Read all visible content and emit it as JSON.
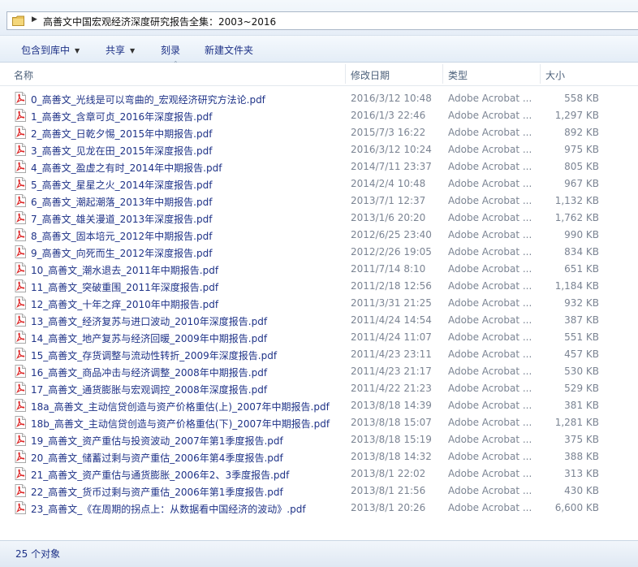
{
  "address": {
    "path": "高善文中国宏观经济深度研究报告全集：2003~2016",
    "folder_icon": "folder-icon",
    "separator_icon": "chevron-right-icon"
  },
  "toolbar": {
    "include_library": "包含到库中",
    "share": "共享",
    "burn": "刻录",
    "new_folder": "新建文件夹"
  },
  "columns": {
    "name": "名称",
    "date": "修改日期",
    "type": "类型",
    "size": "大小"
  },
  "files": [
    {
      "name": "0_高善文_光线是可以弯曲的_宏观经济研究方法论.pdf",
      "date": "2016/3/12 10:48",
      "type": "Adobe Acrobat ...",
      "size": "558 KB"
    },
    {
      "name": "1_高善文_含章可贞_2016年深度报告.pdf",
      "date": "2016/1/3 22:46",
      "type": "Adobe Acrobat ...",
      "size": "1,297 KB"
    },
    {
      "name": "2_高善文_日乾夕惕_2015年中期报告.pdf",
      "date": "2015/7/3 16:22",
      "type": "Adobe Acrobat ...",
      "size": "892 KB"
    },
    {
      "name": "3_高善文_见龙在田_2015年深度报告.pdf",
      "date": "2016/3/12 10:24",
      "type": "Adobe Acrobat ...",
      "size": "975 KB"
    },
    {
      "name": "4_高善文_盈虚之有时_2014年中期报告.pdf",
      "date": "2014/7/11 23:37",
      "type": "Adobe Acrobat ...",
      "size": "805 KB"
    },
    {
      "name": "5_高善文_星星之火_2014年深度报告.pdf",
      "date": "2014/2/4 10:48",
      "type": "Adobe Acrobat ...",
      "size": "967 KB"
    },
    {
      "name": "6_高善文_潮起潮落_2013年中期报告.pdf",
      "date": "2013/7/1 12:37",
      "type": "Adobe Acrobat ...",
      "size": "1,132 KB"
    },
    {
      "name": "7_高善文_雄关漫道_2013年深度报告.pdf",
      "date": "2013/1/6 20:20",
      "type": "Adobe Acrobat ...",
      "size": "1,762 KB"
    },
    {
      "name": "8_高善文_固本培元_2012年中期报告.pdf",
      "date": "2012/6/25 23:40",
      "type": "Adobe Acrobat ...",
      "size": "990 KB"
    },
    {
      "name": "9_高善文_向死而生_2012年深度报告.pdf",
      "date": "2012/2/26 19:05",
      "type": "Adobe Acrobat ...",
      "size": "834 KB"
    },
    {
      "name": "10_高善文_潮水退去_2011年中期报告.pdf",
      "date": "2011/7/14 8:10",
      "type": "Adobe Acrobat ...",
      "size": "651 KB"
    },
    {
      "name": "11_高善文_突破重围_2011年深度报告.pdf",
      "date": "2011/2/18 12:56",
      "type": "Adobe Acrobat ...",
      "size": "1,184 KB"
    },
    {
      "name": "12_高善文_十年之痒_2010年中期报告.pdf",
      "date": "2011/3/31 21:25",
      "type": "Adobe Acrobat ...",
      "size": "932 KB"
    },
    {
      "name": "13_高善文_经济复苏与进口波动_2010年深度报告.pdf",
      "date": "2011/4/24 14:54",
      "type": "Adobe Acrobat ...",
      "size": "387 KB"
    },
    {
      "name": "14_高善文_地产复苏与经济回暖_2009年中期报告.pdf",
      "date": "2011/4/24 11:07",
      "type": "Adobe Acrobat ...",
      "size": "551 KB"
    },
    {
      "name": "15_高善文_存货调整与流动性转折_2009年深度报告.pdf",
      "date": "2011/4/23 23:11",
      "type": "Adobe Acrobat ...",
      "size": "457 KB"
    },
    {
      "name": "16_高善文_商品冲击与经济调整_2008年中期报告.pdf",
      "date": "2011/4/23 21:17",
      "type": "Adobe Acrobat ...",
      "size": "530 KB"
    },
    {
      "name": "17_高善文_通货膨胀与宏观调控_2008年深度报告.pdf",
      "date": "2011/4/22 21:23",
      "type": "Adobe Acrobat ...",
      "size": "529 KB"
    },
    {
      "name": "18a_高善文_主动信贷创造与资产价格重估(上)_2007年中期报告.pdf",
      "date": "2013/8/18 14:39",
      "type": "Adobe Acrobat ...",
      "size": "381 KB"
    },
    {
      "name": "18b_高善文_主动信贷创造与资产价格重估(下)_2007年中期报告.pdf",
      "date": "2013/8/18 15:07",
      "type": "Adobe Acrobat ...",
      "size": "1,281 KB"
    },
    {
      "name": "19_高善文_资产重估与投资波动_2007年第1季度报告.pdf",
      "date": "2013/8/18 15:19",
      "type": "Adobe Acrobat ...",
      "size": "375 KB"
    },
    {
      "name": "20_高善文_储蓄过剩与资产重估_2006年第4季度报告.pdf",
      "date": "2013/8/18 14:32",
      "type": "Adobe Acrobat ...",
      "size": "388 KB"
    },
    {
      "name": "21_高善文_资产重估与通货膨胀_2006年2、3季度报告.pdf",
      "date": "2013/8/1 22:02",
      "type": "Adobe Acrobat ...",
      "size": "313 KB"
    },
    {
      "name": "22_高善文_货币过剩与资产重估_2006年第1季度报告.pdf",
      "date": "2013/8/1 21:56",
      "type": "Adobe Acrobat ...",
      "size": "430 KB"
    },
    {
      "name": "23_高善文_《在周期的拐点上：从数据看中国经济的波动》.pdf",
      "date": "2013/8/1 20:26",
      "type": "Adobe Acrobat ...",
      "size": "6,600 KB"
    }
  ],
  "status": {
    "count": "25 个对象"
  },
  "file_icon": "pdf-file-icon"
}
